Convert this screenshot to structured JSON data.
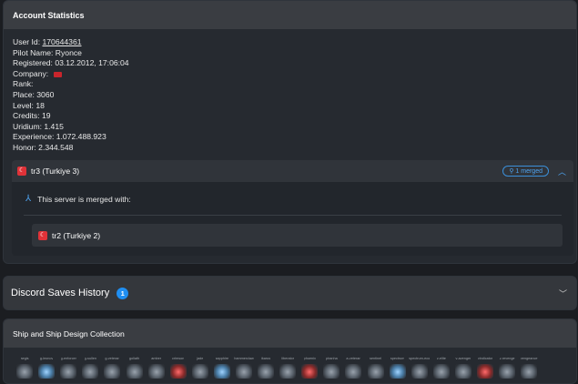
{
  "account": {
    "title": "Account Statistics",
    "user_id_label": "User Id:",
    "user_id": "170644361",
    "pilot_name": "Pilot Name: Ryonce",
    "registered": "Registered: 03.12.2012, 17:06:04",
    "company": "Company:",
    "rank": "Rank:",
    "place": "Place: 3060",
    "level": "Level: 18",
    "credits": "Credits: 19",
    "uridium": "Uridium: 1.415",
    "experience": "Experience: 1.072.488.923",
    "honor": "Honor: 2.344.548"
  },
  "server": {
    "name": "tr3 (Turkiye 3)",
    "merged_badge": "1 merged",
    "merge_message": "This server is merged with:",
    "merged_servers": [
      {
        "name": "tr2 (Turkiye 2)"
      }
    ]
  },
  "discord": {
    "title": "Discord Saves History",
    "count": "1"
  },
  "ships": {
    "title": "Ship and Ship Design Collection",
    "items": [
      {
        "name": "aegis",
        "tint": "gray"
      },
      {
        "name": "g-leonov",
        "tint": "blue"
      },
      {
        "name": "g-enforcer",
        "tint": "gray"
      },
      {
        "name": "g-sullen",
        "tint": "gray"
      },
      {
        "name": "g-veteran",
        "tint": "gray"
      },
      {
        "name": "goliath",
        "tint": "gray"
      },
      {
        "name": "amber",
        "tint": "gray"
      },
      {
        "name": "crimson",
        "tint": "red"
      },
      {
        "name": "jade",
        "tint": "gray"
      },
      {
        "name": "sapphire",
        "tint": "blue"
      },
      {
        "name": "hammerclaw",
        "tint": "gray"
      },
      {
        "name": "ikarus",
        "tint": "gray"
      },
      {
        "name": "liberator",
        "tint": "gray"
      },
      {
        "name": "phoenix",
        "tint": "red"
      },
      {
        "name": "piranha",
        "tint": "gray"
      },
      {
        "name": "a-veteran",
        "tint": "gray"
      },
      {
        "name": "sentinel",
        "tint": "gray"
      },
      {
        "name": "spectrum",
        "tint": "blue"
      },
      {
        "name": "spectrum-eco",
        "tint": "gray"
      },
      {
        "name": "v-elite",
        "tint": "gray"
      },
      {
        "name": "v-avenger",
        "tint": "gray"
      },
      {
        "name": "vindicator",
        "tint": "red"
      },
      {
        "name": "v-revenge",
        "tint": "gray"
      },
      {
        "name": "vengeance",
        "tint": "gray"
      }
    ]
  }
}
